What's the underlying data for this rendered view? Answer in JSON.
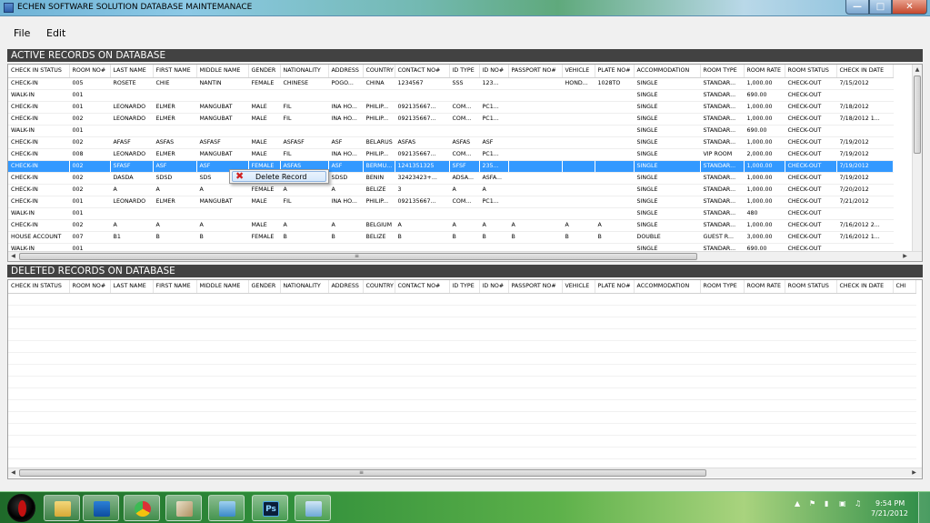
{
  "window": {
    "title": "ECHEN SOFTWARE SOLUTION DATABASE MAINTEMANACE",
    "minimize_icon": "minimize-icon",
    "maximize_icon": "maximize-icon",
    "close_icon": "close-icon"
  },
  "menu": {
    "file": "File",
    "edit": "Edit"
  },
  "active": {
    "header": "ACTIVE RECORDS ON DATABASE",
    "columns": [
      "CHECK IN STATUS",
      "ROOM NO#",
      "LAST NAME",
      "FIRST NAME",
      "MIDDLE NAME",
      "GENDER",
      "NATIONALITY",
      "ADDRESS",
      "COUNTRY",
      "CONTACT NO#",
      "ID TYPE",
      "ID NO#",
      "PASSPORT NO#",
      "VEHICLE",
      "PLATE NO#",
      "ACCOMMODATION",
      "ROOM TYPE",
      "ROOM RATE",
      "ROOM STATUS",
      "CHECK IN DATE"
    ],
    "selected_row": 7,
    "rows": [
      [
        "CHECK-IN",
        "005",
        "ROSETE",
        "CHIE",
        "NANTIN",
        "FEMALE",
        "CHINESE",
        "POGO...",
        "CHINA",
        "1234567",
        "SSS",
        "123...",
        "",
        "HOND...",
        "1028TO",
        "SINGLE",
        "STANDAR...",
        "1,000.00",
        "CHECK-OUT",
        "7/15/2012"
      ],
      [
        "WALK-IN",
        "001",
        "",
        "",
        "",
        "",
        "",
        "",
        "",
        "",
        "",
        "",
        "",
        "",
        "",
        "SINGLE",
        "STANDAR...",
        "690.00",
        "CHECK-OUT",
        ""
      ],
      [
        "CHECK-IN",
        "001",
        "LEONARDO",
        "ELMER",
        "MANGUBAT",
        "MALE",
        "FIL",
        "INA HO...",
        "PHILIP...",
        "092135667...",
        "COM...",
        "PC1...",
        "",
        "",
        "",
        "SINGLE",
        "STANDAR...",
        "1,000.00",
        "CHECK-OUT",
        "7/18/2012"
      ],
      [
        "CHECK-IN",
        "002",
        "LEONARDO",
        "ELMER",
        "MANGUBAT",
        "MALE",
        "FIL",
        "INA HO...",
        "PHILIP...",
        "092135667...",
        "COM...",
        "PC1...",
        "",
        "",
        "",
        "SINGLE",
        "STANDAR...",
        "1,000.00",
        "CHECK-OUT",
        "7/18/2012 1..."
      ],
      [
        "WALK-IN",
        "001",
        "",
        "",
        "",
        "",
        "",
        "",
        "",
        "",
        "",
        "",
        "",
        "",
        "",
        "SINGLE",
        "STANDAR...",
        "690.00",
        "CHECK-OUT",
        ""
      ],
      [
        "CHECK-IN",
        "002",
        "AFASF",
        "ASFAS",
        "ASFASF",
        "MALE",
        "ASFASF",
        "ASF",
        "BELARUS",
        "ASFAS",
        "ASFAS",
        "ASF",
        "",
        "",
        "",
        "SINGLE",
        "STANDAR...",
        "1,000.00",
        "CHECK-OUT",
        "7/19/2012"
      ],
      [
        "CHECK-IN",
        "008",
        "LEONARDO",
        "ELMER",
        "MANGUBAT",
        "MALE",
        "FIL",
        "INA HO...",
        "PHILIP...",
        "092135667...",
        "COM...",
        "PC1...",
        "",
        "",
        "",
        "SINGLE",
        "VIP ROOM",
        "2,000.00",
        "CHECK-OUT",
        "7/19/2012"
      ],
      [
        "CHECK-IN",
        "002",
        "SFASF",
        "ASF",
        "ASF",
        "FEMALE",
        "ASFAS",
        "ASF",
        "BERMU...",
        "1241351325",
        "SFSF",
        "235...",
        "",
        "",
        "",
        "SINGLE",
        "STANDAR...",
        "1,000.00",
        "CHECK-OUT",
        "7/19/2012"
      ],
      [
        "CHECK-IN",
        "002",
        "DASDA",
        "SDSD",
        "SDS",
        "",
        "",
        "SDSD",
        "BENIN",
        "32423423+...",
        "ADSA...",
        "ASFA...",
        "",
        "",
        "",
        "SINGLE",
        "STANDAR...",
        "1,000.00",
        "CHECK-OUT",
        "7/19/2012"
      ],
      [
        "CHECK-IN",
        "002",
        "A",
        "A",
        "A",
        "FEMALE",
        "A",
        "A",
        "BELIZE",
        "3",
        "A",
        "A",
        "",
        "",
        "",
        "SINGLE",
        "STANDAR...",
        "1,000.00",
        "CHECK-OUT",
        "7/20/2012"
      ],
      [
        "CHECK-IN",
        "001",
        "LEONARDO",
        "ELMER",
        "MANGUBAT",
        "MALE",
        "FIL",
        "INA HO...",
        "PHILIP...",
        "092135667...",
        "COM...",
        "PC1...",
        "",
        "",
        "",
        "SINGLE",
        "STANDAR...",
        "1,000.00",
        "CHECK-OUT",
        "7/21/2012"
      ],
      [
        "WALK-IN",
        "001",
        "",
        "",
        "",
        "",
        "",
        "",
        "",
        "",
        "",
        "",
        "",
        "",
        "",
        "SINGLE",
        "STANDAR...",
        "480",
        "CHECK-OUT",
        ""
      ],
      [
        "CHECK-IN",
        "002",
        "A",
        "A",
        "A",
        "MALE",
        "A",
        "A",
        "BELGIUM",
        "A",
        "A",
        "A",
        "A",
        "A",
        "A",
        "SINGLE",
        "STANDAR...",
        "1,000.00",
        "CHECK-OUT",
        "7/16/2012 2..."
      ],
      [
        "HOUSE ACCOUNT",
        "007",
        "B1",
        "B",
        "B",
        "FEMALE",
        "B",
        "B",
        "BELIZE",
        "B",
        "B",
        "B",
        "B",
        "B",
        "B",
        "DOUBLE",
        "GUEST R...",
        "3,000.00",
        "CHECK-OUT",
        "7/16/2012 1..."
      ],
      [
        "WALK-IN",
        "001",
        "",
        "",
        "",
        "",
        "",
        "",
        "",
        "",
        "",
        "",
        "",
        "",
        "",
        "SINGLE",
        "STANDAR...",
        "690.00",
        "CHECK-OUT",
        ""
      ]
    ]
  },
  "deleted": {
    "header": "DELETED RECORDS ON DATABASE",
    "columns": [
      "CHECK IN STATUS",
      "ROOM NO#",
      "LAST NAME",
      "FIRST NAME",
      "MIDDLE NAME",
      "GENDER",
      "NATIONALITY",
      "ADDRESS",
      "COUNTRY",
      "CONTACT NO#",
      "ID TYPE",
      "ID NO#",
      "PASSPORT NO#",
      "VEHICLE",
      "PLATE NO#",
      "ACCOMMODATION",
      "ROOM TYPE",
      "ROOM RATE",
      "ROOM STATUS",
      "CHECK IN DATE",
      "CHI"
    ]
  },
  "context_menu": {
    "delete_label": "Delete Record",
    "icon": "delete-x-icon"
  },
  "taskbar": {
    "apps": [
      "explorer-icon",
      "media-player-icon",
      "chrome-icon",
      "paint-icon",
      "notepad-icon",
      "photoshop-icon",
      "database-app-icon"
    ],
    "photoshop_label": "Ps",
    "time": "9:54 PM",
    "date": "7/21/2012"
  }
}
